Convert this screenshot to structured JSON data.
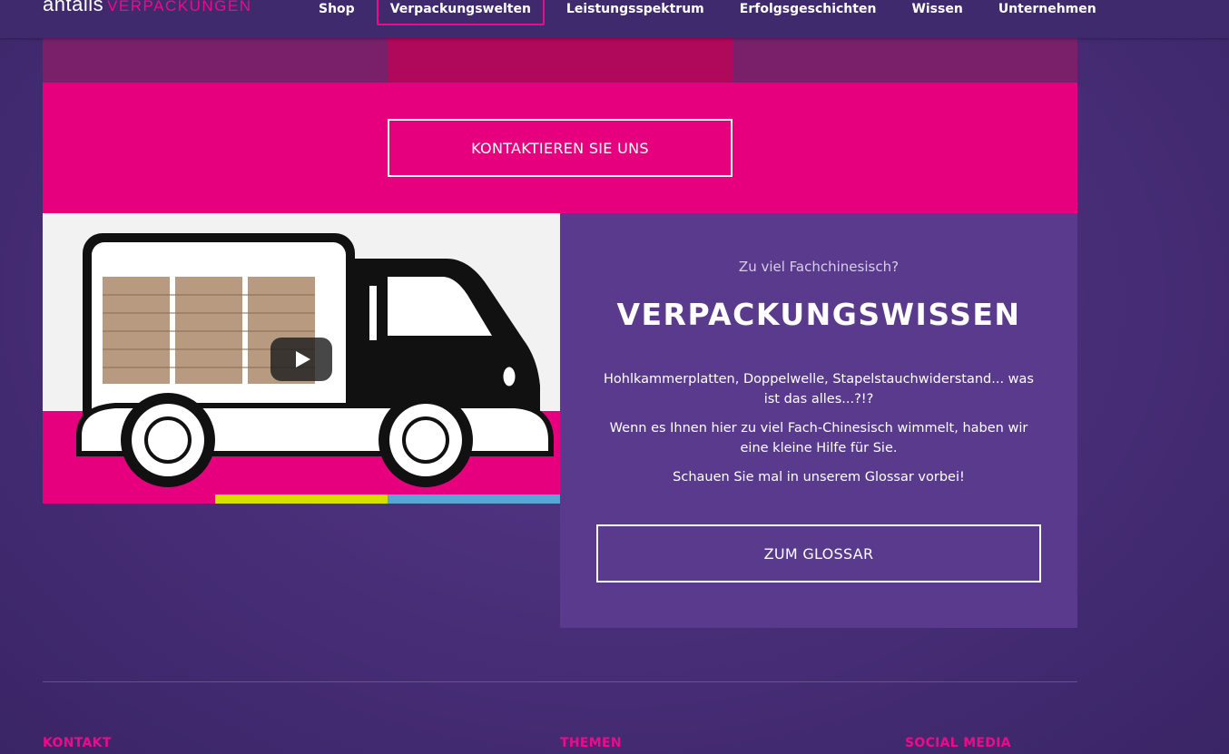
{
  "header": {
    "logo_text": "antalis",
    "logo_suffix": "VERPACKUNGEN",
    "nav": [
      {
        "label": "Shop"
      },
      {
        "label": "Verpackungswelten"
      },
      {
        "label": "Leistungsspektrum"
      },
      {
        "label": "Erfolgsgeschichten"
      },
      {
        "label": "Wissen"
      },
      {
        "label": "Unternehmen"
      }
    ],
    "active_nav": "Verpackungswelten"
  },
  "tiles": {
    "colors": [
      "#7a1f6a",
      "#b0085a",
      "#7a1f6a"
    ]
  },
  "cta": {
    "button_label": "KONTAKTIEREN SIE UNS",
    "background": "#e6007e"
  },
  "video": {
    "play_icon": "play-icon"
  },
  "wissen": {
    "subtitle": "Zu viel Fachchinesisch?",
    "heading": "VERPACKUNGSWISSEN",
    "paragraph1": "Hohlkammerplatten, Doppelwelle, Stapelstauchwiderstand... was ist das alles...?!?",
    "paragraph2": "Wenn es Ihnen hier zu viel Fach-Chinesisch wimmelt, haben wir eine kleine Hilfe für Sie.",
    "paragraph3": "Schauen Sie mal in unserem Glossar vorbei!",
    "button_label": "ZUM GLOSSAR"
  },
  "footer": {
    "col1": "KONTAKT",
    "col2": "THEMEN",
    "col3": "SOCIAL MEDIA"
  },
  "colors": {
    "accent": "#e6007e",
    "panel": "#5a3a8c"
  }
}
